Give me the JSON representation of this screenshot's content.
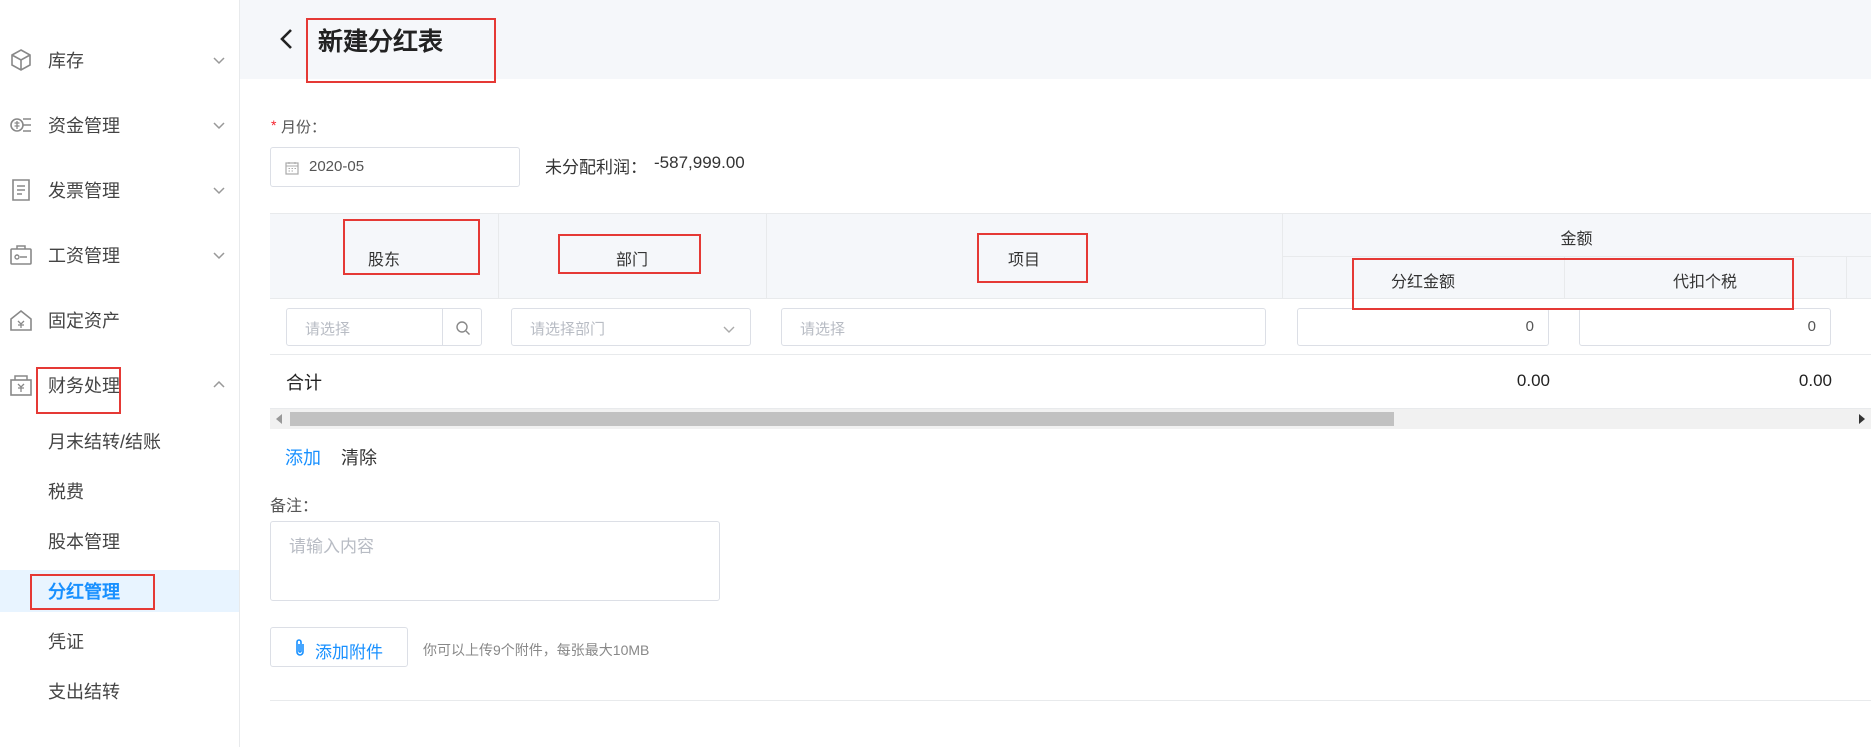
{
  "sidebar": {
    "items": [
      {
        "label": "库存",
        "icon": "box-icon"
      },
      {
        "label": "资金管理",
        "icon": "money-icon"
      },
      {
        "label": "发票管理",
        "icon": "receipt-icon"
      },
      {
        "label": "工资管理",
        "icon": "wallet-icon"
      },
      {
        "label": "固定资产",
        "icon": "house-icon"
      },
      {
        "label": "财务处理",
        "icon": "finance-icon"
      }
    ],
    "sub_items": [
      "月末结转/结账",
      "税费",
      "股本管理",
      "分红管理",
      "凭证",
      "支出结转"
    ],
    "active_sub": "分红管理"
  },
  "header": {
    "title": "新建分红表"
  },
  "form": {
    "required_mark": "*",
    "month_label": "月份：",
    "month_value": "2020-05",
    "profit_label": "未分配利润：",
    "profit_value": "-587,999.00"
  },
  "table": {
    "headers": {
      "shareholder": "股东",
      "department": "部门",
      "project": "项目",
      "amount": "金额",
      "dividend_amount": "分红金额",
      "withheld_tax": "代扣个税"
    },
    "row": {
      "shareholder_placeholder": "请选择",
      "department_placeholder": "请选择部门",
      "project_placeholder": "请选择",
      "dividend_amount": "0",
      "withheld_tax": "0"
    },
    "total": {
      "label": "合计",
      "dividend_amount": "0.00",
      "withheld_tax": "0.00"
    }
  },
  "actions": {
    "add": "添加",
    "clear": "清除"
  },
  "remark": {
    "label": "备注：",
    "placeholder": "请输入内容"
  },
  "attachment": {
    "button_label": "添加附件",
    "hint": "你可以上传9个附件，每张最大10MB"
  },
  "colors": {
    "accent": "#1890ff",
    "annotation": "#e53935"
  }
}
